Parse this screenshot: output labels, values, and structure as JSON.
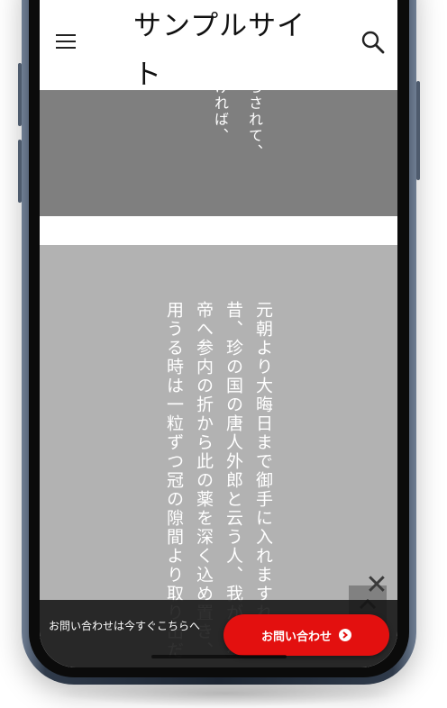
{
  "header": {
    "site_title": "サンプルサイト"
  },
  "hero": {
    "vertical_text": "ろされて、\nければ、"
  },
  "article": {
    "vertical_text": "元朝より大晦日まで御手に入れますれ\n昔、珍の国の唐人外郎と云う人、我が朝へ\n帝へ参内の折から此の薬を深く込め置き、\n用うる時は一粒ずつ冠の隙間より取り出だ"
  },
  "contact_bar": {
    "message": "お問い合わせは今すぐこちらへ",
    "button_label": "お問い合わせ"
  },
  "icons": {
    "menu": "hamburger-icon",
    "search": "search-icon",
    "close": "close-icon",
    "scroll_top": "chevron-up-icon",
    "button_arrow": "chevron-right-icon"
  },
  "colors": {
    "accent": "#e3100f",
    "band_dark": "#7f7f7f",
    "band_light": "#b2b2b2",
    "contact_bar_bg": "#141414"
  }
}
